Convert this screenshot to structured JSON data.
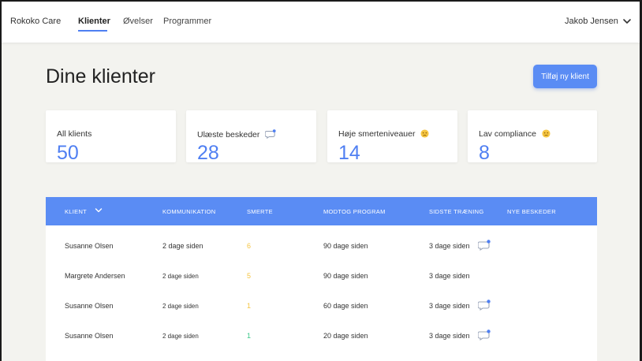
{
  "nav": {
    "brand": "Rokoko Care",
    "links": [
      {
        "label": "Klienter",
        "active": true
      },
      {
        "label": "Øvelser",
        "active": false
      },
      {
        "label": "Programmer",
        "active": false
      }
    ],
    "user": "Jakob Jensen"
  },
  "page": {
    "title": "Dine klienter",
    "add_button": "Tilføj ny klient"
  },
  "stats": [
    {
      "label": "All klients",
      "value": "50",
      "icon": ""
    },
    {
      "label": "Ulæste beskeder",
      "value": "28",
      "icon": "message-icon"
    },
    {
      "label": "Høje smerteniveauer",
      "value": "14",
      "icon": "sad-face-icon"
    },
    {
      "label": "Lav compliance",
      "value": "8",
      "icon": "neutral-face-icon"
    }
  ],
  "table": {
    "headers": [
      "KLIENT",
      "KOMMUNIKATION",
      "SMERTE",
      "MODTOG PROGRAM",
      "SIDSTE TRÆNING",
      "NYE BESKEDER"
    ],
    "rows": [
      {
        "name": "Susanne Olsen",
        "communication": "2 dage siden",
        "pain": "6",
        "pain_color": "#f5c542",
        "program": "90 dage siden",
        "training": "3 dage siden",
        "new_message": true
      },
      {
        "name": "Margrete Andersen",
        "communication": "2 dage siden",
        "pain": "5",
        "pain_color": "#f5c542",
        "program": "90 dage siden",
        "training": "3 dage siden",
        "new_message": false
      },
      {
        "name": "Susanne Olsen",
        "communication": "2 dage siden",
        "pain": "1",
        "pain_color": "#f5c542",
        "program": "60 dage siden",
        "training": "3 dage siden",
        "new_message": true
      },
      {
        "name": "Susanne Olsen",
        "communication": "2 dage siden",
        "pain": "1",
        "pain_color": "#3cc88a",
        "program": "20 dage siden",
        "training": "3 dage siden",
        "new_message": true
      }
    ]
  },
  "colors": {
    "accent": "#5a8cf4",
    "stat_value": "#4f7ff2",
    "pain_mid": "#f5c542",
    "pain_low": "#3cc88a"
  }
}
